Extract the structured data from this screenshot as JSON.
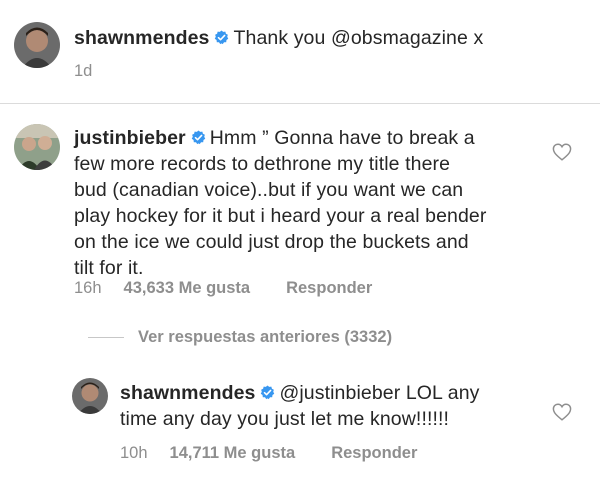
{
  "post": {
    "username": "shawnmendes",
    "caption": "Thank you @obsmagazine x",
    "time": "1d"
  },
  "comment": {
    "username": "justinbieber",
    "lines": [
      "Hmm ” Gonna have to break a",
      "few more records to dethrone my title there",
      "bud (canadian voice)..but if you want we can",
      "play hockey for it but i heard your a real bender",
      "on the ice  we could just drop the buckets and",
      "tilt for it."
    ],
    "time": "16h",
    "likes": "43,633 Me gusta",
    "reply_label": "Responder"
  },
  "view_replies": "Ver respuestas anteriores (3332)",
  "reply": {
    "username": "shawnmendes",
    "lines": [
      "@justinbieber LOL any",
      "time any day you just let me know!!!!!!"
    ],
    "time": "10h",
    "likes": "14,711 Me gusta",
    "reply_label": "Responder"
  },
  "colors": {
    "verified": "#3897f0",
    "muted": "#8e8e8e",
    "text": "#262626"
  },
  "icons": {
    "verified": "verified-badge-icon",
    "like": "heart-outline-icon"
  }
}
